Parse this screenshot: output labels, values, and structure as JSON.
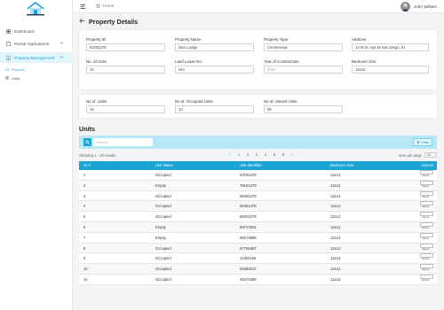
{
  "user": {
    "name": "John William"
  },
  "breadcrumb": {
    "home": "Home"
  },
  "sidebar": {
    "items": [
      {
        "label": "Dashboard"
      },
      {
        "label": "Rental Applications"
      },
      {
        "label": "Property Management"
      }
    ],
    "sub_items": [
      {
        "label": "Property"
      },
      {
        "label": "Units"
      }
    ]
  },
  "page": {
    "title": "Property Details",
    "units_title": "Units"
  },
  "property": {
    "fields": [
      {
        "label": "Property ID",
        "value": "63791379"
      },
      {
        "label": "Property Name",
        "value": "Dice Lodge"
      },
      {
        "label": "Property Type",
        "value": "Commercial"
      },
      {
        "label": "Address",
        "value": "13 W.St. Apt 48 San Diego, 91"
      },
      {
        "label": "No. of Units",
        "value": "10"
      },
      {
        "label": "Land Lease No.",
        "value": "NIA"
      },
      {
        "label": "Year of Construction",
        "value": "2020"
      },
      {
        "label": "Bedroom Size",
        "value": "12x12"
      }
    ]
  },
  "counts": {
    "fields": [
      {
        "label": "No of. Units",
        "value": "15"
      },
      {
        "label": "No of. Occupied Units",
        "value": "10"
      },
      {
        "label": "No of. Vacant Units",
        "value": "05"
      }
    ]
  },
  "search": {
    "placeholder": "Search",
    "filter_label": "Filter"
  },
  "pagination": {
    "results": "Showing 1 - 15 results",
    "prev": "‹",
    "next": "›",
    "pages": [
      "1",
      "2",
      "3",
      "4",
      "5",
      "6"
    ],
    "current": "1",
    "items_per_page_label": "Item per page",
    "items_per_page": "10"
  },
  "table": {
    "headers": [
      "Sr #",
      "Unit Name",
      "Unit Identifier",
      "Bedroom Size",
      "Actions"
    ],
    "action_label": "Select",
    "rows": [
      [
        "1",
        "Occupied",
        "63791379",
        "12x12"
      ],
      [
        "2",
        "Empty",
        "79191379",
        "12x12"
      ],
      [
        "3",
        "Occupied",
        "59491379",
        "12x12"
      ],
      [
        "4",
        "Occupied",
        "68491379",
        "12x12"
      ],
      [
        "5",
        "Occupied",
        "66201379",
        "12x12"
      ],
      [
        "6",
        "Empty",
        "98747824",
        "12x12"
      ],
      [
        "7",
        "Empty",
        "98274989",
        "12x12"
      ],
      [
        "8",
        "Occupied",
        "67765487",
        "12x12"
      ],
      [
        "9",
        "Occupied",
        "11362165",
        "12x12"
      ],
      [
        "10",
        "Occupied",
        "91894917",
        "12x12"
      ],
      [
        "11",
        "Occupied",
        "25472389",
        "12x12"
      ]
    ]
  },
  "colors": {
    "accent": "#1aa5d4",
    "search_bg": "#b8e7f7",
    "active_bg": "#e2f5fb"
  }
}
